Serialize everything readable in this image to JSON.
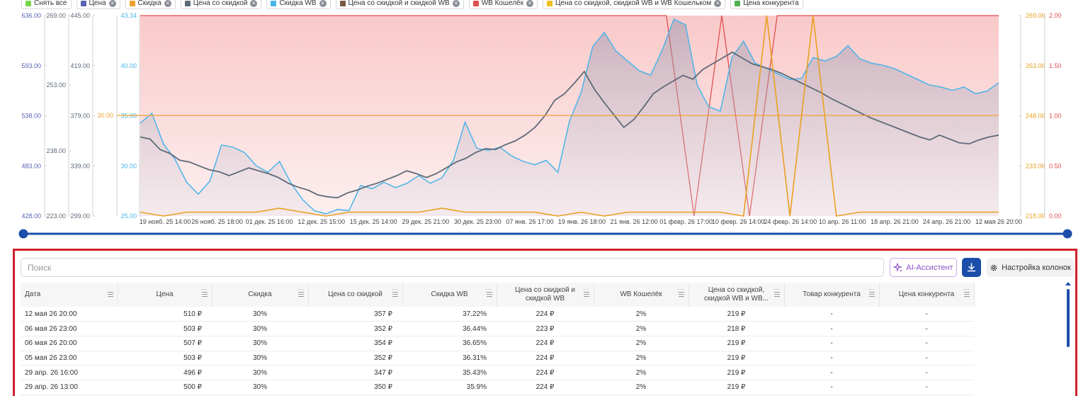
{
  "legend": [
    {
      "label": "Снять все",
      "color": "#77d44a",
      "closable": false
    },
    {
      "label": "Цена",
      "color": "#5a62b4",
      "closable": true
    },
    {
      "label": "Скидка",
      "color": "#f0a030",
      "closable": true
    },
    {
      "label": "Цена со скидкой",
      "color": "#5f6a78",
      "closable": true
    },
    {
      "label": "Скидка WB",
      "color": "#4ab4e8",
      "closable": true
    },
    {
      "label": "Цена со скидкой и скидкой WB",
      "color": "#7a5a44",
      "closable": true
    },
    {
      "label": "WB Кошелёк",
      "color": "#e05050",
      "closable": true
    },
    {
      "label": "Цена со скидкой, скидкой WB и WB Кошельком",
      "color": "#f0c020",
      "closable": true
    },
    {
      "label": "Цена конкурента",
      "color": "#50b050",
      "closable": false
    }
  ],
  "chart_data": {
    "type": "line",
    "x_ticks": [
      "19 нояб. 25 14:00",
      "26 нояб. 25 18:00",
      "01 дек. 25 16:00",
      "12 дек. 25 15:00",
      "15 дек. 25 14:00",
      "29 дек. 25 21:00",
      "30 дек. 25 23:00",
      "07 янв. 26 17:00",
      "19 янв. 26 18:00",
      "21 янв. 26 12:00",
      "01 февр. 26 17:00",
      "10 февр. 26 14:00",
      "24 февр. 26 14:00",
      "10 апр. 26 11:00",
      "18 апр. 26 21:00",
      "24 апр. 26 21:00",
      "12 мая 26 20:00"
    ],
    "axes": {
      "price": {
        "ticks": [
          "636.00",
          "593.00",
          "538.00",
          "483.00",
          "428.00"
        ],
        "color": "#5a62b4"
      },
      "price_discount": {
        "ticks": [
          "269.00",
          "253.00",
          "238.00",
          "223.00"
        ],
        "color": "#5f6a78"
      },
      "price_discount_wb": {
        "ticks": [
          "445.00",
          "419.00",
          "379.00",
          "339.00",
          "299.00"
        ],
        "color": "#5f6a78"
      },
      "discount": {
        "ticks": [
          "30.00"
        ],
        "color": "#f0a030"
      },
      "discount_wb": {
        "ticks": [
          "43.34",
          "40.00",
          "35.00",
          "30.00",
          "25.00"
        ],
        "color": "#4ab4e8"
      },
      "final_price": {
        "ticks": [
          "269.00",
          "263.00",
          "248.00",
          "233.00",
          "218.00"
        ],
        "color": "#e8a020"
      },
      "wallet": {
        "ticks": [
          "2.00",
          "1.50",
          "1.00",
          "0.50",
          "0.00"
        ],
        "color": "#e05050"
      }
    },
    "series": [
      {
        "name": "Цена",
        "axis_range": [
          428,
          636
        ],
        "color": "#5f6a78",
        "values": [
          510,
          508,
          497,
          493,
          486,
          484,
          480,
          476,
          474,
          470,
          474,
          478,
          475,
          472,
          468,
          462,
          458,
          455,
          450,
          448,
          447,
          452,
          455,
          459,
          462,
          466,
          470,
          475,
          472,
          468,
          472,
          478,
          484,
          488,
          494,
          498,
          497,
          502,
          506,
          512,
          520,
          532,
          548,
          555,
          566,
          578,
          560,
          546,
          533,
          520,
          528,
          541,
          555,
          562,
          568,
          574,
          570,
          580,
          586,
          592,
          598,
          592,
          586,
          583,
          580,
          576,
          571,
          566,
          561,
          556,
          550,
          545,
          540,
          535,
          530,
          526,
          522,
          518,
          514,
          510,
          507,
          512,
          508,
          504,
          503,
          507,
          510,
          512
        ]
      },
      {
        "name": "Скидка WB",
        "axis_range": [
          25,
          43.34
        ],
        "color": "#4ab4e8",
        "values": [
          33.5,
          34.4,
          31.6,
          30.2,
          28.1,
          27.0,
          28.2,
          31.5,
          31.3,
          30.8,
          29.6,
          29.0,
          30.0,
          28.0,
          26.5,
          25.5,
          25.2,
          25.6,
          25.5,
          27.8,
          27.5,
          28.1,
          27.6,
          28.0,
          28.7,
          28.0,
          28.5,
          30.1,
          33.6,
          31.2,
          31.0,
          31.3,
          30.5,
          30.0,
          29.7,
          30.1,
          29.0,
          33.7,
          36.3,
          40.5,
          41.8,
          40.1,
          39.2,
          38.3,
          37.9,
          40.2,
          43.0,
          42.5,
          37.0,
          35.0,
          34.6,
          39.5,
          41.0,
          39.0,
          38.5,
          38.0,
          37.5,
          37.6,
          39.5,
          39.2,
          39.6,
          40.6,
          39.4,
          39.0,
          38.8,
          38.5,
          38.0,
          37.5,
          37.0,
          36.8,
          36.5,
          36.8,
          36.2,
          36.44,
          37.2
        ]
      },
      {
        "name": "WB Кошелёк",
        "axis_range": [
          0,
          2
        ],
        "color": "#e05050",
        "values": [
          2,
          2,
          2,
          2,
          2,
          2,
          2,
          2,
          2,
          2,
          2,
          2,
          2,
          2,
          2,
          2,
          2,
          2,
          2,
          2,
          0,
          2,
          0,
          2,
          2,
          2,
          2,
          2,
          2,
          2,
          2,
          2
        ]
      },
      {
        "name": "Цена со скидкой, скидкой WB и WB Кошельком",
        "axis_range": [
          218,
          269
        ],
        "color": "#e8a020",
        "values": [
          219,
          218,
          219,
          219,
          219,
          219,
          220,
          219,
          218,
          219,
          219,
          219,
          219,
          220,
          219,
          219,
          219,
          219,
          218,
          219,
          218,
          219,
          219,
          219,
          219,
          219,
          218,
          269,
          218,
          269,
          218,
          219,
          219,
          219,
          219,
          219,
          219,
          219
        ]
      },
      {
        "name": "Скидка",
        "axis_range": [
          0,
          60
        ],
        "color": "#f0a030",
        "values": [
          30,
          30,
          30,
          30,
          30,
          30,
          30,
          30,
          30,
          30,
          30,
          30,
          30,
          30,
          30,
          30
        ]
      }
    ]
  },
  "search": {
    "placeholder": "Поиск"
  },
  "toolbar": {
    "ai_label": "AI-Ассистент",
    "columns_label": "Настройка колонок"
  },
  "table": {
    "headers": [
      "Дата",
      "Цена",
      "Скидка",
      "Цена со скидкой",
      "Скидка WB",
      "Цена со скидкой и скидкой WB",
      "WB Кошелёк",
      "Цена со скидкой, скидкой WB и WB...",
      "Товар конкурента",
      "Цена конкурента"
    ],
    "rows": [
      [
        "12 мая 26 20:00",
        "510 ₽",
        "30%",
        "357 ₽",
        "37.22%",
        "224 ₽",
        "2%",
        "219 ₽",
        "-",
        "-"
      ],
      [
        "06 мая 26 23:00",
        "503 ₽",
        "30%",
        "352 ₽",
        "36.44%",
        "223 ₽",
        "2%",
        "218 ₽",
        "-",
        "-"
      ],
      [
        "06 мая 26 20:00",
        "507 ₽",
        "30%",
        "354 ₽",
        "36.65%",
        "224 ₽",
        "2%",
        "219 ₽",
        "-",
        "-"
      ],
      [
        "05 мая 26 23:00",
        "503 ₽",
        "30%",
        "352 ₽",
        "36.31%",
        "224 ₽",
        "2%",
        "219 ₽",
        "-",
        "-"
      ],
      [
        "29 апр. 26 16:00",
        "496 ₽",
        "30%",
        "347 ₽",
        "35.43%",
        "224 ₽",
        "2%",
        "219 ₽",
        "-",
        "-"
      ],
      [
        "29 апр. 26 13:00",
        "500 ₽",
        "30%",
        "350 ₽",
        "35.9%",
        "224 ₽",
        "2%",
        "219 ₽",
        "-",
        "-"
      ]
    ]
  }
}
